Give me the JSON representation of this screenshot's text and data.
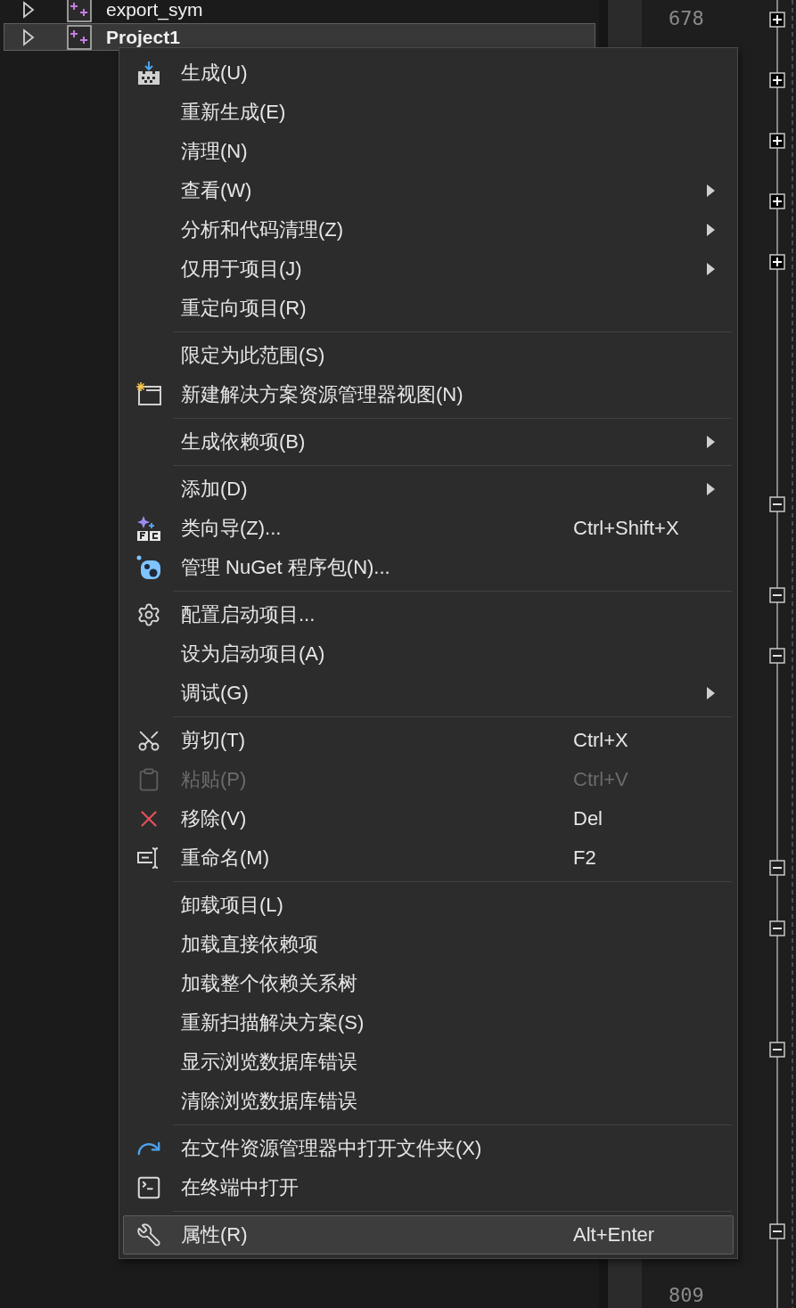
{
  "explorer": {
    "rows": [
      {
        "label": "export_sym",
        "selected": false
      },
      {
        "label": "Project1",
        "selected": true
      }
    ]
  },
  "line_numbers": [
    "678",
    "809"
  ],
  "context_menu": {
    "groups": [
      {
        "items": [
          {
            "kind": "build",
            "label": "生成(U)",
            "submenu": false,
            "disabled": false,
            "selected": false
          },
          {
            "kind": "plain",
            "label": "重新生成(E)",
            "submenu": false,
            "disabled": false,
            "selected": false
          },
          {
            "kind": "plain",
            "label": "清理(N)",
            "submenu": false,
            "disabled": false,
            "selected": false
          },
          {
            "kind": "plain",
            "label": "查看(W)",
            "submenu": true,
            "disabled": false,
            "selected": false
          },
          {
            "kind": "plain",
            "label": "分析和代码清理(Z)",
            "submenu": true,
            "disabled": false,
            "selected": false
          },
          {
            "kind": "plain",
            "label": "仅用于项目(J)",
            "submenu": true,
            "disabled": false,
            "selected": false
          },
          {
            "kind": "plain",
            "label": "重定向项目(R)",
            "submenu": false,
            "disabled": false,
            "selected": false
          }
        ]
      },
      {
        "items": [
          {
            "kind": "plain",
            "label": "限定为此范围(S)",
            "submenu": false,
            "disabled": false,
            "selected": false
          },
          {
            "kind": "new-view",
            "label": "新建解决方案资源管理器视图(N)",
            "submenu": false,
            "disabled": false,
            "selected": false
          }
        ]
      },
      {
        "items": [
          {
            "kind": "plain",
            "label": "生成依赖项(B)",
            "submenu": true,
            "disabled": false,
            "selected": false
          }
        ]
      },
      {
        "items": [
          {
            "kind": "plain",
            "label": "添加(D)",
            "submenu": true,
            "disabled": false,
            "selected": false
          },
          {
            "kind": "class-wizard",
            "label": "类向导(Z)...",
            "shortcut": "Ctrl+Shift+X",
            "submenu": false,
            "disabled": false,
            "selected": false
          },
          {
            "kind": "nuget",
            "label": "管理 NuGet 程序包(N)...",
            "submenu": false,
            "disabled": false,
            "selected": false
          }
        ]
      },
      {
        "items": [
          {
            "kind": "gear",
            "label": "配置启动项目...",
            "submenu": false,
            "disabled": false,
            "selected": false
          },
          {
            "kind": "plain",
            "label": "设为启动项目(A)",
            "submenu": false,
            "disabled": false,
            "selected": false
          },
          {
            "kind": "plain",
            "label": "调试(G)",
            "submenu": true,
            "disabled": false,
            "selected": false
          }
        ]
      },
      {
        "items": [
          {
            "kind": "cut",
            "label": "剪切(T)",
            "shortcut": "Ctrl+X",
            "submenu": false,
            "disabled": false,
            "selected": false
          },
          {
            "kind": "paste",
            "label": "粘贴(P)",
            "shortcut": "Ctrl+V",
            "submenu": false,
            "disabled": true,
            "selected": false
          },
          {
            "kind": "remove",
            "label": "移除(V)",
            "shortcut": "Del",
            "submenu": false,
            "disabled": false,
            "selected": false
          },
          {
            "kind": "rename",
            "label": "重命名(M)",
            "shortcut": "F2",
            "submenu": false,
            "disabled": false,
            "selected": false
          }
        ]
      },
      {
        "items": [
          {
            "kind": "plain",
            "label": "卸载项目(L)",
            "submenu": false,
            "disabled": false,
            "selected": false
          },
          {
            "kind": "plain",
            "label": "加载直接依赖项",
            "submenu": false,
            "disabled": false,
            "selected": false
          },
          {
            "kind": "plain",
            "label": "加载整个依赖关系树",
            "submenu": false,
            "disabled": false,
            "selected": false
          },
          {
            "kind": "plain",
            "label": "重新扫描解决方案(S)",
            "submenu": false,
            "disabled": false,
            "selected": false
          },
          {
            "kind": "plain",
            "label": "显示浏览数据库错误",
            "submenu": false,
            "disabled": false,
            "selected": false
          },
          {
            "kind": "plain",
            "label": "清除浏览数据库错误",
            "submenu": false,
            "disabled": false,
            "selected": false
          }
        ]
      },
      {
        "items": [
          {
            "kind": "open-folder",
            "label": "在文件资源管理器中打开文件夹(X)",
            "submenu": false,
            "disabled": false,
            "selected": false
          },
          {
            "kind": "terminal",
            "label": "在终端中打开",
            "submenu": false,
            "disabled": false,
            "selected": false
          }
        ]
      },
      {
        "items": [
          {
            "kind": "wrench",
            "label": "属性(R)",
            "shortcut": "Alt+Enter",
            "submenu": false,
            "disabled": false,
            "selected": true
          }
        ]
      }
    ]
  }
}
